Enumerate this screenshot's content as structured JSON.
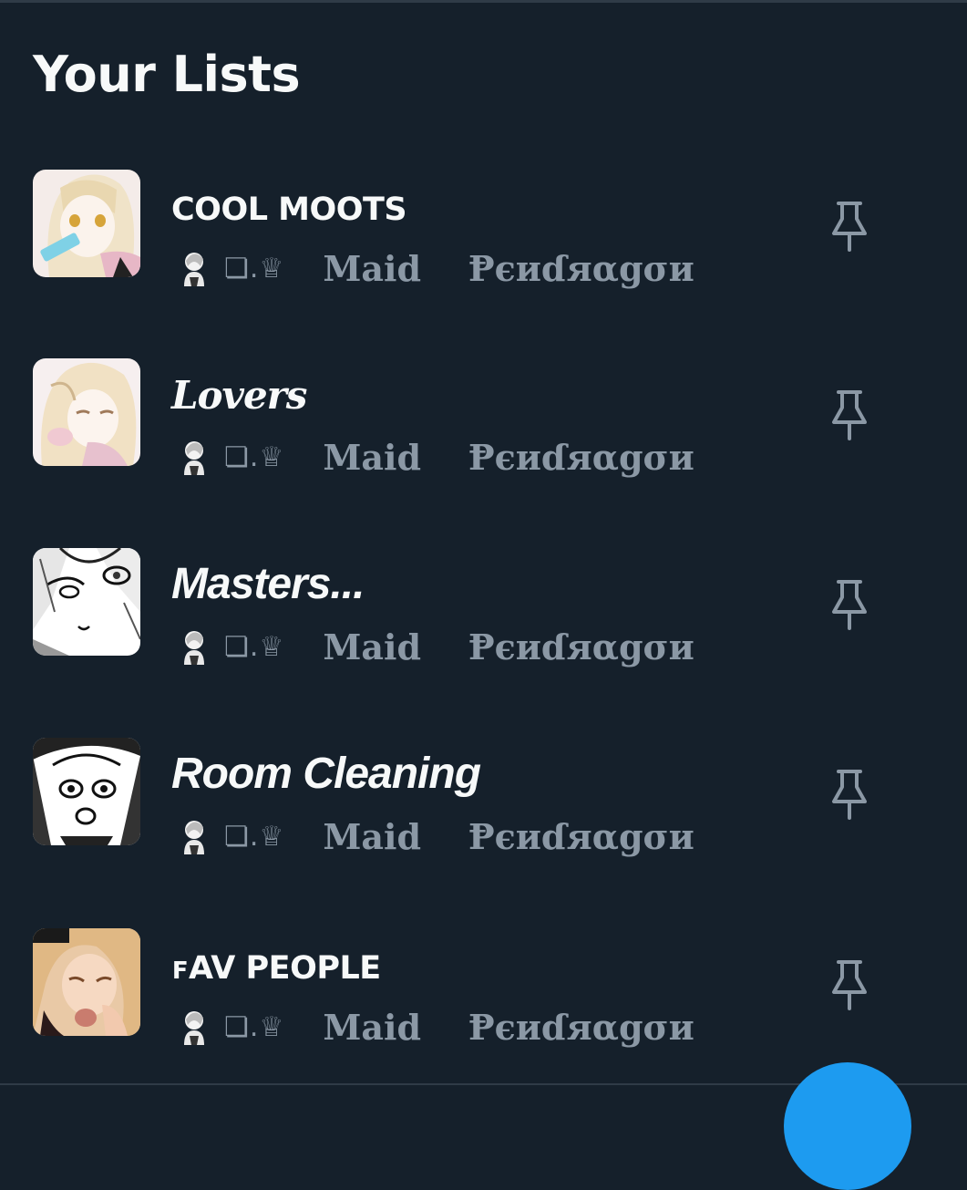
{
  "page": {
    "title": "Your Lists"
  },
  "lists": [
    {
      "name": "COOL MOOTS",
      "name_style": "caps",
      "owner_glyphs": "❏.♕",
      "owner_word": "Maid",
      "owner_surname": "Ᵽєиɗяαgσи",
      "pin_icon": "pin-icon"
    },
    {
      "name": "Lovers",
      "name_style": "serif-italic",
      "owner_glyphs": "❏.♕",
      "owner_word": "Maid",
      "owner_surname": "Ᵽєиɗяαgσи",
      "pin_icon": "pin-icon"
    },
    {
      "name": "Masters...",
      "name_style": "sans-italic",
      "owner_glyphs": "❏.♕",
      "owner_word": "Maid",
      "owner_surname": "Ᵽєиɗяαgσи",
      "pin_icon": "pin-icon"
    },
    {
      "name": "Room Cleaning",
      "name_style": "sans-italic",
      "owner_glyphs": "❏.♕",
      "owner_word": "Maid",
      "owner_surname": "Ᵽєиɗяαgσи",
      "pin_icon": "pin-icon"
    },
    {
      "name": "ꜰAV PEOPLE",
      "name_style": "caps",
      "owner_glyphs": "❏.♕",
      "owner_word": "Maid",
      "owner_surname": "Ᵽєиɗяαgσи",
      "pin_icon": "pin-icon"
    }
  ],
  "colors": {
    "background": "#15202b",
    "primary_text": "#f7f9f9",
    "secondary_text": "#8b98a5",
    "accent": "#1d9bf0"
  }
}
